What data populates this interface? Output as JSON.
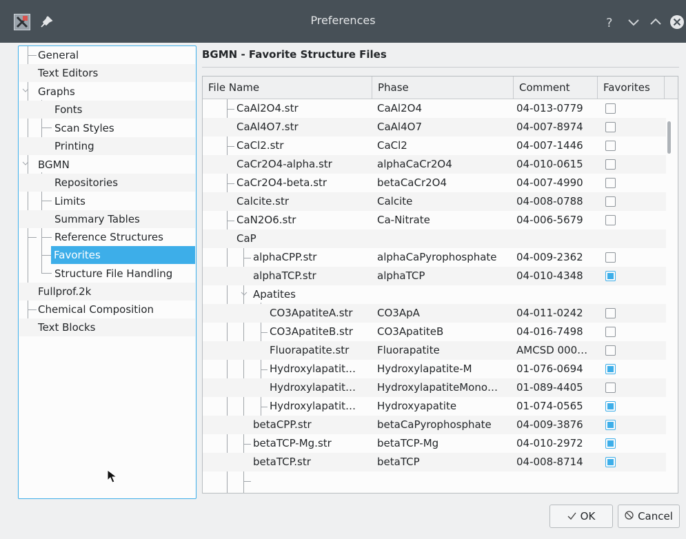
{
  "window": {
    "title": "Preferences"
  },
  "sidebar": {
    "items": [
      {
        "label": "General",
        "level": 1
      },
      {
        "label": "Text Editors",
        "level": 1
      },
      {
        "label": "Graphs",
        "level": 1,
        "expanded": true
      },
      {
        "label": "Fonts",
        "level": 2
      },
      {
        "label": "Scan Styles",
        "level": 2
      },
      {
        "label": "Printing",
        "level": 2
      },
      {
        "label": "BGMN",
        "level": 1,
        "expanded": true
      },
      {
        "label": "Repositories",
        "level": 2
      },
      {
        "label": "Limits",
        "level": 2
      },
      {
        "label": "Summary Tables",
        "level": 2
      },
      {
        "label": "Reference Structures",
        "level": 2
      },
      {
        "label": "Favorites",
        "level": 2,
        "selected": true
      },
      {
        "label": "Structure File Handling",
        "level": 2
      },
      {
        "label": "Fullprof.2k",
        "level": 1
      },
      {
        "label": "Chemical Composition",
        "level": 1
      },
      {
        "label": "Text Blocks",
        "level": 1
      }
    ]
  },
  "main": {
    "title": "BGMN - Favorite Structure Files",
    "columns": [
      "File Name",
      "Phase",
      "Comment",
      "Favorites"
    ],
    "rows": [
      {
        "file": "CaAl2O4.str",
        "phase": "CaAl2O4",
        "comment": "04-013-0779",
        "fav": false,
        "level": 1
      },
      {
        "file": "CaAl4O7.str",
        "phase": "CaAl4O7",
        "comment": "04-007-8974",
        "fav": false,
        "level": 1
      },
      {
        "file": "CaCl2.str",
        "phase": "CaCl2",
        "comment": "04-007-1446",
        "fav": false,
        "level": 1
      },
      {
        "file": "CaCr2O4-alpha.str",
        "phase": "alphaCaCr2O4",
        "comment": "04-010-0615",
        "fav": false,
        "level": 1
      },
      {
        "file": "CaCr2O4-beta.str",
        "phase": "betaCaCr2O4",
        "comment": "04-007-4990",
        "fav": false,
        "level": 1
      },
      {
        "file": "Calcite.str",
        "phase": "Calcite",
        "comment": "04-008-0788",
        "fav": false,
        "level": 1
      },
      {
        "file": "CaN2O6.str",
        "phase": "Ca-Nitrate",
        "comment": "04-006-5679",
        "fav": false,
        "level": 1
      },
      {
        "file": "CaP",
        "phase": "",
        "comment": "",
        "fav": null,
        "level": 1,
        "folder": true
      },
      {
        "file": "alphaCPP.str",
        "phase": "alphaCaPyrophosphate",
        "comment": "04-009-2362",
        "fav": false,
        "level": 2
      },
      {
        "file": "alphaTCP.str",
        "phase": "alphaTCP",
        "comment": "04-010-4348",
        "fav": true,
        "level": 2
      },
      {
        "file": "Apatites",
        "phase": "",
        "comment": "",
        "fav": null,
        "level": 2,
        "folder": true
      },
      {
        "file": "CO3ApatiteA.str",
        "phase": "CO3ApA",
        "comment": "04-011-0242",
        "fav": false,
        "level": 3
      },
      {
        "file": "CO3ApatiteB.str",
        "phase": "CO3ApatiteB",
        "comment": "04-016-7498",
        "fav": false,
        "level": 3
      },
      {
        "file": "Fluorapatite.str",
        "phase": "Fluorapatite",
        "comment": "AMCSD 000…",
        "fav": false,
        "level": 3
      },
      {
        "file": "Hydroxylapatit…",
        "phase": "Hydroxylapatite-M",
        "comment": "01-076-0694",
        "fav": true,
        "level": 3
      },
      {
        "file": "Hydroxylapatit…",
        "phase": "HydroxylapatiteMono…",
        "comment": "01-089-4405",
        "fav": false,
        "level": 3
      },
      {
        "file": "Hydroxylapatit…",
        "phase": "Hydroxyapatite",
        "comment": "01-074-0565",
        "fav": true,
        "level": 3
      },
      {
        "file": "betaCPP.str",
        "phase": "betaCaPyrophosphate",
        "comment": "04-009-3876",
        "fav": true,
        "level": 2
      },
      {
        "file": "betaTCP-Mg.str",
        "phase": "betaTCP-Mg",
        "comment": "04-010-2972",
        "fav": true,
        "level": 2
      },
      {
        "file": "betaTCP.str",
        "phase": "betaTCP",
        "comment": "04-008-8714",
        "fav": true,
        "level": 2
      }
    ]
  },
  "footer": {
    "ok_label": "OK",
    "cancel_label": "Cancel"
  }
}
